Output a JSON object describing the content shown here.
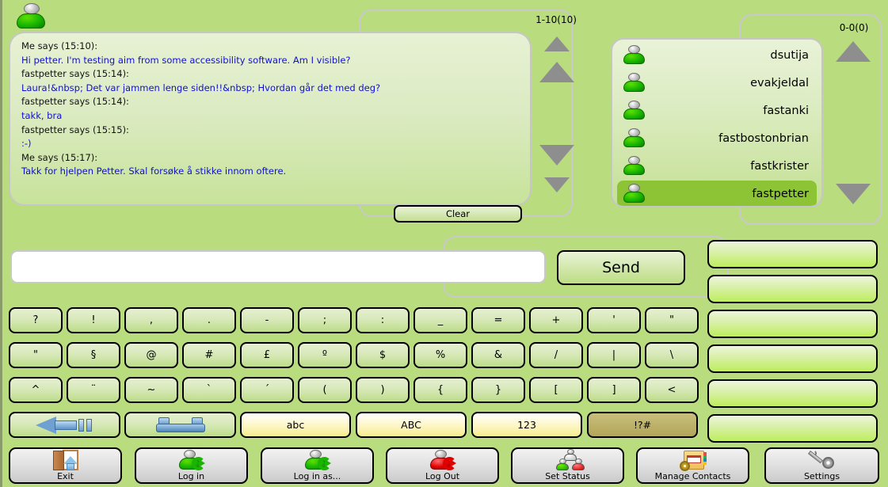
{
  "status_avatar": {
    "icon": "person-online-icon",
    "state": "online"
  },
  "chat": {
    "count_label": "1-10(10)",
    "clear_label": "Clear",
    "lines": [
      {
        "type": "header",
        "text": "Me says (15:10):"
      },
      {
        "type": "message",
        "text": "Hi petter.  I'm testing aim  from some accessibility software. Am I visible?"
      },
      {
        "type": "header",
        "text": "fastpetter says (15:14):"
      },
      {
        "type": "message",
        "text": "Laura!&nbsp; Det var jammen lenge siden!!&nbsp; Hvordan går det med deg?"
      },
      {
        "type": "header",
        "text": "fastpetter says (15:14):"
      },
      {
        "type": "message",
        "text": "takk, bra"
      },
      {
        "type": "header",
        "text": "fastpetter says (15:15):"
      },
      {
        "type": "message",
        "text": ":-)"
      },
      {
        "type": "header",
        "text": "Me says (15:17):"
      },
      {
        "type": "message",
        "text": "Takk for hjelpen Petter.  Skal forsøke å stikke innom oftere."
      }
    ],
    "scroll": {
      "page_up_icon": "triangle-up-small-icon",
      "line_up_icon": "triangle-up-icon",
      "line_down_icon": "triangle-down-icon",
      "page_down_icon": "triangle-down-small-icon"
    }
  },
  "contacts": {
    "count_label": "0-0(0)",
    "items": [
      {
        "name": "dsutija",
        "icon": "person-online-icon",
        "selected": false
      },
      {
        "name": "evakjeldal",
        "icon": "person-online-icon",
        "selected": false
      },
      {
        "name": "fastanki",
        "icon": "person-online-icon",
        "selected": false
      },
      {
        "name": "fastbostonbrian",
        "icon": "person-online-icon",
        "selected": false
      },
      {
        "name": "fastkrister",
        "icon": "person-online-icon",
        "selected": false
      },
      {
        "name": "fastpetter",
        "icon": "person-online-icon",
        "selected": true
      }
    ],
    "scroll": {
      "up_icon": "triangle-up-icon",
      "down_icon": "triangle-down-icon"
    }
  },
  "compose": {
    "input_value": "",
    "input_placeholder": "",
    "send_label": "Send"
  },
  "keyboard": {
    "rows": [
      [
        "?",
        "!",
        ",",
        ".",
        "-",
        ";",
        ":",
        "_",
        "=",
        "+",
        "'",
        "\""
      ],
      [
        "\"",
        "§",
        "@",
        "#",
        "£",
        "º",
        "$",
        "%",
        "&",
        "/",
        "|",
        "\\"
      ],
      [
        "^",
        "¨",
        "~",
        "`",
        "´",
        "(",
        ")",
        "{",
        "}",
        "[",
        "]",
        "<"
      ]
    ],
    "bottom": {
      "backspace_icon": "backspace-arrow-icon",
      "space_icon": "spacebar-icon",
      "abc_label": "abc",
      "ABC_label": "ABC",
      "num_label": "123",
      "sym_label": "!?#",
      "sym_active": true
    }
  },
  "side_buttons": {
    "count": 6,
    "labels": [
      "",
      "",
      "",
      "",
      "",
      ""
    ]
  },
  "toolbar": {
    "buttons": [
      {
        "label": "Exit",
        "icon": "exit-door-icon"
      },
      {
        "label": "Log in",
        "icon": "login-person-icon"
      },
      {
        "label": "Log in as...",
        "icon": "login-as-person-icon"
      },
      {
        "label": "Log Out",
        "icon": "logout-person-icon"
      },
      {
        "label": "Set Status",
        "icon": "set-status-people-icon"
      },
      {
        "label": "Manage Contacts",
        "icon": "address-book-gear-icon"
      },
      {
        "label": "Settings",
        "icon": "wrench-gear-icon"
      }
    ]
  },
  "colors": {
    "background": "#b9dc7f",
    "panel_light": "#e7f1d4",
    "selection": "#8cc435",
    "message_text": "#1111cc",
    "header_text": "#111111"
  }
}
